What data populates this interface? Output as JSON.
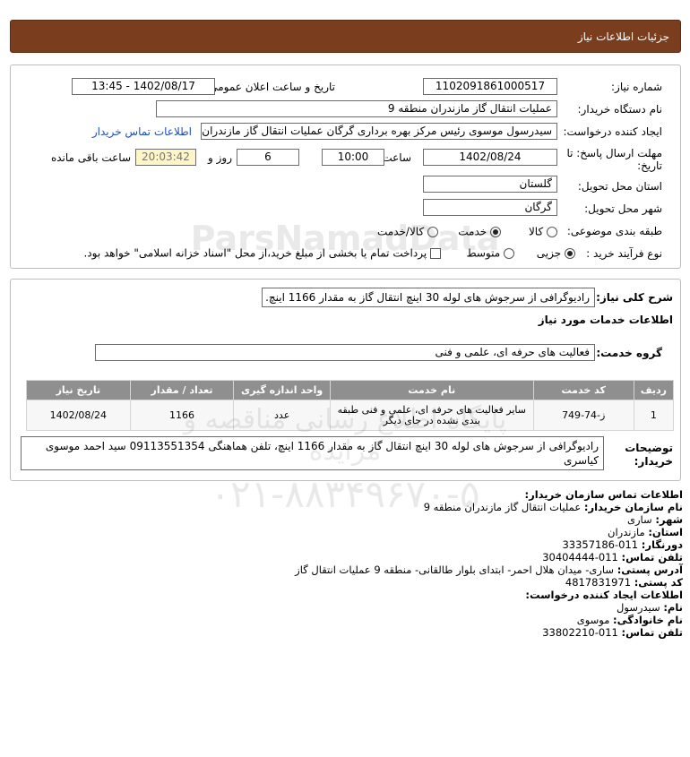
{
  "header": {
    "title": "جزئیات اطلاعات نیاز"
  },
  "need": {
    "number_label": "شماره نیاز:",
    "number_value": "1102091861000517",
    "announce_label": "تاریخ و ساعت اعلان عمومی:",
    "announce_value": "1402/08/17 - 13:45",
    "buyer_org_label": "نام دستگاه خریدار:",
    "buyer_org_value": "عملیات انتقال گاز مازندران منطقه 9",
    "creator_label": "ایجاد کننده درخواست:",
    "creator_value": "سیدرسول موسوی رئیس مرکز بهره برداری گرگان عملیات انتقال گاز مازندران منط",
    "contact_link": "اطلاعات تماس خریدار",
    "deadline_label_1": "مهلت ارسال پاسخ: تا",
    "deadline_label_2": "تاریخ:",
    "deadline_date": "1402/08/24",
    "time_label": "ساعت",
    "deadline_time": "10:00",
    "days_value": "6",
    "days_label": "روز و",
    "remaining_value": "20:03:42",
    "remaining_label": "ساعت باقی مانده",
    "province_label": "استان محل تحویل:",
    "province_value": "گلستان",
    "city_label": "شهر محل تحویل:",
    "city_value": "گرگان",
    "category_label": "طبقه بندی موضوعی:",
    "category_options": [
      "کالا",
      "خدمت",
      "کالا/خدمت"
    ],
    "category_selected": "خدمت",
    "process_label": "نوع فرآیند خرید :",
    "process_options": [
      "جزیی",
      "متوسط"
    ],
    "process_selected": "جزیی",
    "treasury_text": "پرداخت تمام یا بخشی از مبلغ خرید،از محل \"اسناد خزانه اسلامی\" خواهد بود."
  },
  "description": {
    "label": "شرح کلی نیاز:",
    "value": "رادیوگرافی از سرجوش های لوله 30 اینچ انتقال گاز به مقدار 1166 اینچ."
  },
  "services": {
    "section_title": "اطلاعات خدمات مورد نیاز",
    "group_label": "گروه خدمت:",
    "group_value": "فعالیت های حرفه ای، علمی و فنی",
    "table_headers": [
      "ردیف",
      "کد خدمت",
      "نام خدمت",
      "واحد اندازه گیری",
      "تعداد / مقدار",
      "تاریخ نیاز"
    ],
    "rows": [
      {
        "row": "1",
        "code": "ز-74-749",
        "name": "سایر فعالیت های حرفه ای، علمی و فنی طبقه بندی نشده در جای دیگر",
        "unit": "عدد",
        "qty": "1166",
        "date": "1402/08/24"
      }
    ],
    "buyer_notes_label_1": "توضیحات",
    "buyer_notes_label_2": "خریدار:",
    "buyer_notes_value": "رادیوگرافی از سرجوش های لوله 30 اینچ انتقال گاز به مقدار 1166 اینچ، تلفن هماهنگی 09113551354 سید احمد موسوی کیاسری"
  },
  "contact": {
    "title": "اطلاعات تماس سازمان خریدار:",
    "org_label": "نام سازمان خریدار:",
    "org_value": "عملیات انتقال گاز مازندران منطقه 9",
    "city_label": "شهر:",
    "city_value": "ساری",
    "province_label": "استان:",
    "province_value": "مازندران",
    "fax_label": "دورنگار:",
    "fax_value": "011-33357186",
    "phone_label": "تلفن تماس:",
    "phone_value": "011-30404444",
    "address_label": "آدرس پستی:",
    "address_value": "ساری- میدان هلال احمر- ابتدای بلوار طالقانی- منطقه 9 عملیات انتقال گاز",
    "postal_label": "کد پستی:",
    "postal_value": "4817831971",
    "creator_title": "اطلاعات ایجاد کننده درخواست:",
    "first_name_label": "نام:",
    "first_name_value": "سیدرسول",
    "last_name_label": "نام خانوادگی:",
    "last_name_value": "موسوی",
    "creator_phone_label": "تلفن تماس:",
    "creator_phone_value": "011-33802210"
  },
  "watermark": {
    "logo_text": "ParsNamadData",
    "phone": "۰۲۱-۸۸۳۴۹۶۷۰-۵",
    "tagline": "پایگاه اطلاع رسانی مناقصه و مزایده"
  }
}
